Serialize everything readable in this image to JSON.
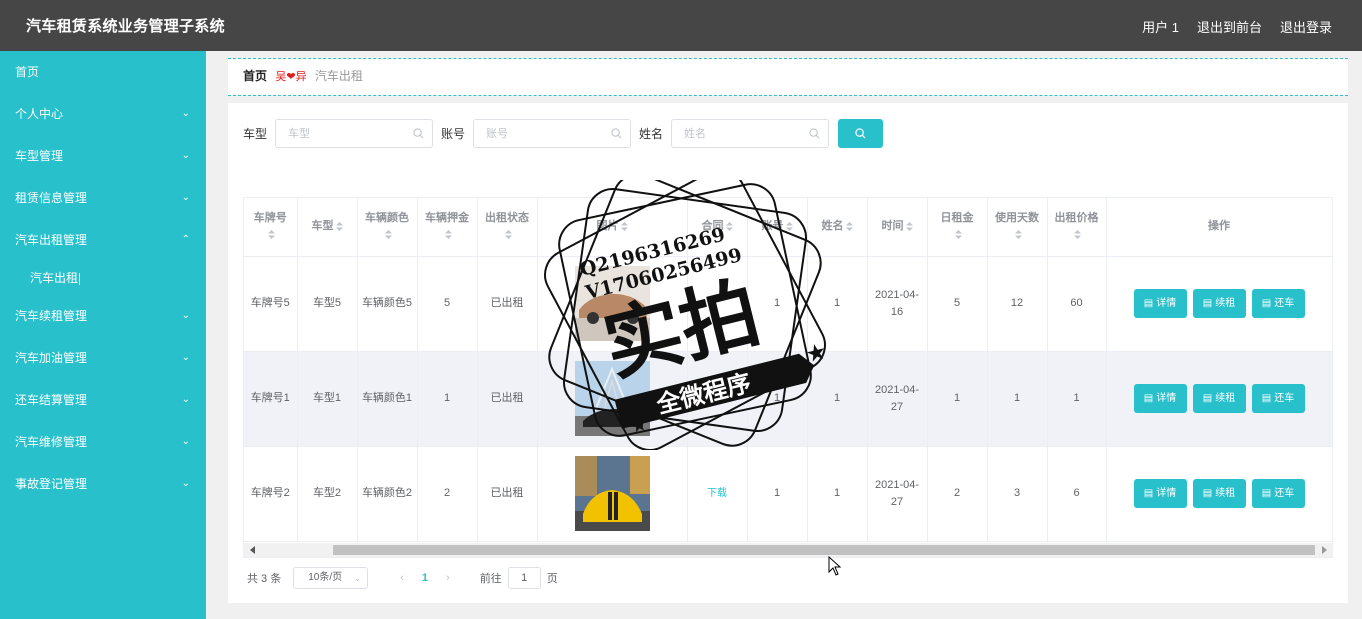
{
  "header": {
    "title": "汽车租赁系统业务管理子系统",
    "user": "用户 1",
    "to_front": "退出到前台",
    "logout": "退出登录"
  },
  "sidebar": {
    "items": [
      {
        "label": "首页",
        "arrow": ""
      },
      {
        "label": "个人中心",
        "arrow": "⌄"
      },
      {
        "label": "车型管理",
        "arrow": "⌄"
      },
      {
        "label": "租赁信息管理",
        "arrow": "⌄"
      },
      {
        "label": "汽车出租管理",
        "arrow": "⌃"
      },
      {
        "label": "汽车续租管理",
        "arrow": "⌄"
      },
      {
        "label": "汽车加油管理",
        "arrow": "⌄"
      },
      {
        "label": "还车结算管理",
        "arrow": "⌄"
      },
      {
        "label": "汽车维修管理",
        "arrow": "⌄"
      },
      {
        "label": "事故登记管理",
        "arrow": "⌄"
      }
    ],
    "sub_item": "汽车出租"
  },
  "breadcrumb": {
    "home": "首页",
    "sep": "❤",
    "current": "汽车出租"
  },
  "search": {
    "car_type_label": "车型",
    "car_type_placeholder": "车型",
    "account_label": "账号",
    "account_placeholder": "账号",
    "name_label": "姓名",
    "name_placeholder": "姓名"
  },
  "table": {
    "headers": [
      "车牌号",
      "车型",
      "车辆颜色",
      "车辆押金",
      "出租状态",
      "图片",
      "合同",
      "账号",
      "姓名",
      "时间",
      "日租金",
      "使用天数",
      "出租价格",
      "操作"
    ],
    "rows": [
      {
        "plate": "车牌号5",
        "type": "车型5",
        "color": "车辆颜色5",
        "deposit": "5",
        "status": "已出租",
        "contract": "",
        "account": "1",
        "name": "1",
        "time": "2021-04-16",
        "daily": "5",
        "days": "12",
        "price": "60"
      },
      {
        "plate": "车牌号1",
        "type": "车型1",
        "color": "车辆颜色1",
        "deposit": "1",
        "status": "已出租",
        "contract": "",
        "account": "1",
        "name": "1",
        "time": "2021-04-27",
        "daily": "1",
        "days": "1",
        "price": "1"
      },
      {
        "plate": "车牌号2",
        "type": "车型2",
        "color": "车辆颜色2",
        "deposit": "2",
        "status": "已出租",
        "contract": "下载",
        "account": "1",
        "name": "1",
        "time": "2021-04-27",
        "daily": "2",
        "days": "3",
        "price": "6"
      }
    ],
    "ops": {
      "detail": "详情",
      "renew": "续租",
      "return": "还车"
    }
  },
  "pager": {
    "total": "共 3 条",
    "page_size": "10条/页",
    "current_page": "1",
    "goto_label": "前往",
    "goto_value": "1",
    "page_suffix": "页"
  },
  "watermark": {
    "qq": "Q2196316269",
    "vx": "V17060256499",
    "main": "实拍",
    "banner": "全微程序"
  },
  "colors": {
    "accent": "#27c0cb",
    "header": "#464646"
  }
}
